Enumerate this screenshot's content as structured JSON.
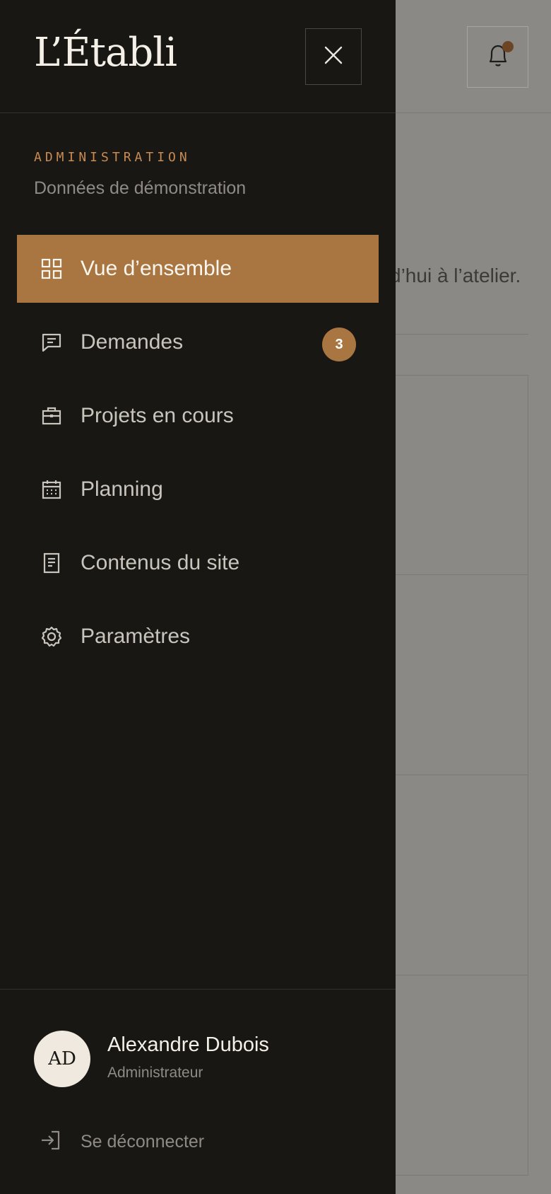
{
  "app": {
    "logo": "L’Établi"
  },
  "background": {
    "text_partial_1": "’",
    "text_partial_2": "d’hui à l’atelier."
  },
  "drawer": {
    "section_label": "ADMINISTRATION",
    "section_sub": "Données de démonstration",
    "nav": [
      {
        "label": "Vue d’ensemble",
        "icon": "grid-icon",
        "active": true
      },
      {
        "label": "Demandes",
        "icon": "message-icon",
        "badge": "3"
      },
      {
        "label": "Projets en cours",
        "icon": "briefcase-icon"
      },
      {
        "label": "Planning",
        "icon": "calendar-icon"
      },
      {
        "label": "Contenus du site",
        "icon": "document-icon"
      },
      {
        "label": "Paramètres",
        "icon": "gear-icon"
      }
    ],
    "user": {
      "initials": "AD",
      "name": "Alexandre Dubois",
      "role": "Administrateur"
    },
    "logout_label": "Se déconnecter"
  },
  "colors": {
    "accent": "#a97540",
    "drawer_bg": "#181714",
    "overlay_bg": "#8a8986"
  }
}
